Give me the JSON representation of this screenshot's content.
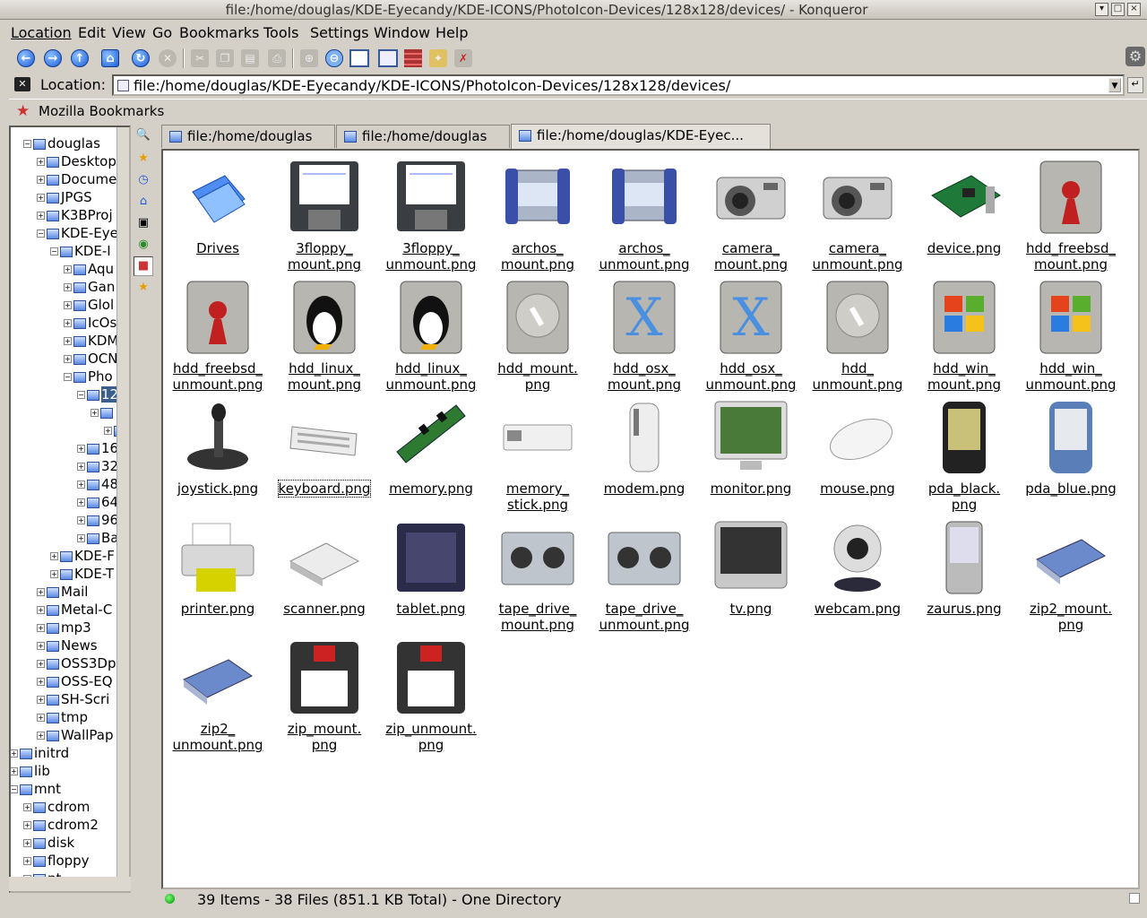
{
  "window": {
    "title": "file:/home/douglas/KDE-Eyecandy/KDE-ICONS/PhotoIcon-Devices/128x128/devices/ - Konqueror"
  },
  "menu": [
    "Location",
    "Edit",
    "View",
    "Go",
    "Bookmarks",
    "Tools",
    "Settings",
    "Window",
    "Help"
  ],
  "toolbar": {
    "icons": [
      "back-icon",
      "forward-icon",
      "up-icon",
      "home-icon",
      "reload-icon",
      "stop-icon",
      "cut-icon",
      "copy-icon",
      "paste-icon",
      "print-icon",
      "zoom-in-icon",
      "zoom-out-icon",
      "icon-view-icon",
      "tree-view-icon",
      "split-view-icon",
      "security-icon",
      "stop-animations-icon"
    ]
  },
  "location": {
    "label": "Location:",
    "value": "file:/home/douglas/KDE-Eyecandy/KDE-ICONS/PhotoIcon-Devices/128x128/devices/"
  },
  "bookmarks": {
    "label": "Mozilla Bookmarks"
  },
  "tree": [
    {
      "label": "douglas",
      "level": 0
    },
    {
      "label": "Desktop",
      "level": 1
    },
    {
      "label": "Docume",
      "level": 1
    },
    {
      "label": "JPGS",
      "level": 1
    },
    {
      "label": "K3BProj",
      "level": 1
    },
    {
      "label": "KDE-Eye",
      "level": 1
    },
    {
      "label": "KDE-I",
      "level": 2
    },
    {
      "label": "Aqu",
      "level": 3
    },
    {
      "label": "Gan",
      "level": 3
    },
    {
      "label": "Glol",
      "level": 3
    },
    {
      "label": "IcOs",
      "level": 3
    },
    {
      "label": "KDM",
      "level": 3
    },
    {
      "label": "OCN",
      "level": 3
    },
    {
      "label": "Pho",
      "level": 3
    },
    {
      "label": "12",
      "level": 4
    },
    {
      "label": "",
      "level": 5
    },
    {
      "label": "",
      "level": 6
    },
    {
      "label": "16",
      "level": 4
    },
    {
      "label": "32",
      "level": 4
    },
    {
      "label": "48",
      "level": 4
    },
    {
      "label": "64",
      "level": 4
    },
    {
      "label": "96",
      "level": 4
    },
    {
      "label": "Ba",
      "level": 4
    },
    {
      "label": "KDE-F",
      "level": 2
    },
    {
      "label": "KDE-T",
      "level": 2
    },
    {
      "label": "Mail",
      "level": 1
    },
    {
      "label": "Metal-C",
      "level": 1
    },
    {
      "label": "mp3",
      "level": 1
    },
    {
      "label": "News",
      "level": 1
    },
    {
      "label": "OSS3Dp",
      "level": 1
    },
    {
      "label": "OSS-EQ",
      "level": 1
    },
    {
      "label": "SH-Scri",
      "level": 1
    },
    {
      "label": "tmp",
      "level": 1
    },
    {
      "label": "WallPap",
      "level": 1
    },
    {
      "label": "initrd",
      "level": -1
    },
    {
      "label": "lib",
      "level": -1
    },
    {
      "label": "mnt",
      "level": -1
    },
    {
      "label": "cdrom",
      "level": 0
    },
    {
      "label": "cdrom2",
      "level": 0
    },
    {
      "label": "disk",
      "level": 0
    },
    {
      "label": "floppy",
      "level": 0
    },
    {
      "label": "nt",
      "level": 0
    }
  ],
  "tabs": [
    "file:/home/douglas",
    "file:/home/douglas",
    "file:/home/douglas/KDE-Eyec..."
  ],
  "items": [
    {
      "l1": "Drives",
      "l2": "",
      "icon": "folder-icon"
    },
    {
      "l1": "3floppy_",
      "l2": "mount.png",
      "icon": "floppy-icon"
    },
    {
      "l1": "3floppy_",
      "l2": "unmount.png",
      "icon": "floppy-icon"
    },
    {
      "l1": "archos_",
      "l2": "mount.png",
      "icon": "archos-icon"
    },
    {
      "l1": "archos_",
      "l2": "unmount.png",
      "icon": "archos-icon"
    },
    {
      "l1": "camera_",
      "l2": "mount.png",
      "icon": "camera-icon"
    },
    {
      "l1": "camera_",
      "l2": "unmount.png",
      "icon": "camera-icon"
    },
    {
      "l1": "device.png",
      "l2": "",
      "icon": "pci-card-icon"
    },
    {
      "l1": "hdd_freebsd_",
      "l2": "mount.png",
      "icon": "hdd-freebsd-icon"
    },
    {
      "l1": "hdd_freebsd_",
      "l2": "unmount.png",
      "icon": "hdd-freebsd-icon"
    },
    {
      "l1": "hdd_linux_",
      "l2": "mount.png",
      "icon": "hdd-linux-icon"
    },
    {
      "l1": "hdd_linux_",
      "l2": "unmount.png",
      "icon": "hdd-linux-icon"
    },
    {
      "l1": "hdd_mount.",
      "l2": "png",
      "icon": "hdd-icon"
    },
    {
      "l1": "hdd_osx_",
      "l2": "mount.png",
      "icon": "hdd-osx-icon"
    },
    {
      "l1": "hdd_osx_",
      "l2": "unmount.png",
      "icon": "hdd-osx-icon"
    },
    {
      "l1": "hdd_",
      "l2": "unmount.png",
      "icon": "hdd-icon"
    },
    {
      "l1": "hdd_win_",
      "l2": "mount.png",
      "icon": "hdd-windows-icon"
    },
    {
      "l1": "hdd_win_",
      "l2": "unmount.png",
      "icon": "hdd-windows-icon"
    },
    {
      "l1": "joystick.png",
      "l2": "",
      "icon": "joystick-icon"
    },
    {
      "l1": "keyboard.png",
      "l2": "",
      "icon": "keyboard-icon"
    },
    {
      "l1": "memory.png",
      "l2": "",
      "icon": "memory-icon"
    },
    {
      "l1": "memory_",
      "l2": "stick.png",
      "icon": "memory-stick-icon"
    },
    {
      "l1": "modem.png",
      "l2": "",
      "icon": "modem-icon"
    },
    {
      "l1": "monitor.png",
      "l2": "",
      "icon": "monitor-icon"
    },
    {
      "l1": "mouse.png",
      "l2": "",
      "icon": "mouse-icon"
    },
    {
      "l1": "pda_black.",
      "l2": "png",
      "icon": "pda-black-icon"
    },
    {
      "l1": "pda_blue.png",
      "l2": "",
      "icon": "pda-blue-icon"
    },
    {
      "l1": "printer.png",
      "l2": "",
      "icon": "printer-icon"
    },
    {
      "l1": "scanner.png",
      "l2": "",
      "icon": "scanner-icon"
    },
    {
      "l1": "tablet.png",
      "l2": "",
      "icon": "tablet-icon"
    },
    {
      "l1": "tape_drive_",
      "l2": "mount.png",
      "icon": "tape-drive-icon"
    },
    {
      "l1": "tape_drive_",
      "l2": "unmount.png",
      "icon": "tape-drive-icon"
    },
    {
      "l1": "tv.png",
      "l2": "",
      "icon": "tv-icon"
    },
    {
      "l1": "webcam.png",
      "l2": "",
      "icon": "webcam-icon"
    },
    {
      "l1": "zaurus.png",
      "l2": "",
      "icon": "zaurus-icon"
    },
    {
      "l1": "zip2_mount.",
      "l2": "png",
      "icon": "zip-drive-icon"
    },
    {
      "l1": "zip2_",
      "l2": "unmount.png",
      "icon": "zip-drive-icon"
    },
    {
      "l1": "zip_mount.",
      "l2": "png",
      "icon": "zip-disk-icon"
    },
    {
      "l1": "zip_unmount.",
      "l2": "png",
      "icon": "zip-disk-icon"
    }
  ],
  "status": {
    "text": "39 Items - 38 Files (851.1 KB Total) - One Directory"
  }
}
